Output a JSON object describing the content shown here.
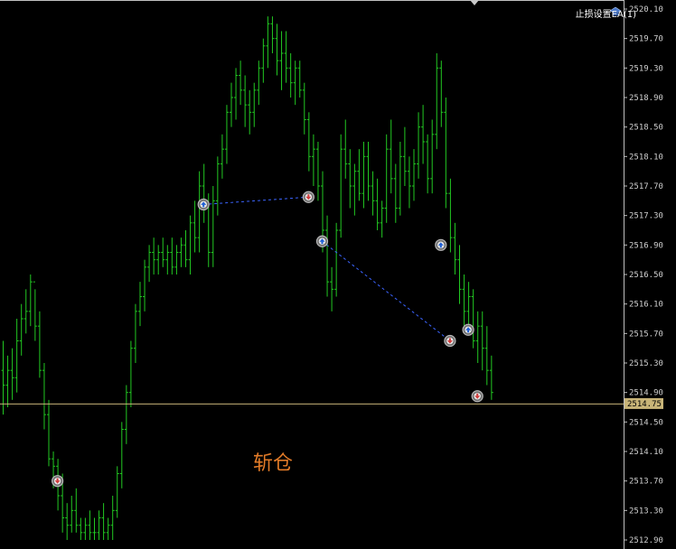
{
  "window": {
    "ea_name": "止损设置EA(1)",
    "overlay_text": "斩仓"
  },
  "colors": {
    "background": "#000000",
    "candle": "#22c822",
    "grid_axis": "#c0c0c0",
    "current_price_line": "#c8b478",
    "price_tag_bg": "#c8b478",
    "trade_link": "#3b64ff",
    "overlay_text": "#e07a28",
    "buy_arrow": "#1e5fd6",
    "sell_arrow": "#d23c3c"
  },
  "icons": {
    "ea_icon": "graduation-cap-icon",
    "buy_marker": "buy-arrow-icon",
    "sell_marker": "sell-arrow-icon"
  },
  "chart_data": {
    "type": "ohlc",
    "price_scale": {
      "min": 2512.9,
      "max": 2520.1,
      "tick_labels": [
        "2520.10",
        "2519.70",
        "2519.30",
        "2518.90",
        "2518.50",
        "2518.10",
        "2517.70",
        "2517.30",
        "2516.90",
        "2516.50",
        "2516.10",
        "2515.70",
        "2515.30",
        "2514.90",
        "2514.50",
        "2514.10",
        "2513.70",
        "2513.30",
        "2512.90"
      ]
    },
    "current_price": 2514.75,
    "current_price_label": "2514.75",
    "bars": [
      [
        2515.2,
        2515.6,
        2514.6,
        2515.0
      ],
      [
        2515.0,
        2515.4,
        2514.7,
        2515.2
      ],
      [
        2515.2,
        2515.5,
        2514.8,
        2515.1
      ],
      [
        2515.1,
        2515.9,
        2514.9,
        2515.6
      ],
      [
        2515.6,
        2516.1,
        2515.4,
        2515.9
      ],
      [
        2515.9,
        2516.3,
        2515.7,
        2516.0
      ],
      [
        2516.0,
        2516.5,
        2515.8,
        2516.4
      ],
      [
        2516.4,
        2516.3,
        2515.6,
        2515.8
      ],
      [
        2515.8,
        2516.0,
        2515.1,
        2515.2
      ],
      [
        2515.2,
        2515.3,
        2514.4,
        2514.6
      ],
      [
        2514.6,
        2514.8,
        2513.9,
        2514.0
      ],
      [
        2514.0,
        2514.1,
        2513.6,
        2513.9
      ],
      [
        2513.9,
        2514.0,
        2513.3,
        2513.5
      ],
      [
        2513.5,
        2513.8,
        2513.0,
        2513.2
      ],
      [
        2513.2,
        2513.4,
        2512.9,
        2513.1
      ],
      [
        2513.1,
        2513.5,
        2513.0,
        2513.3
      ],
      [
        2513.3,
        2513.6,
        2513.0,
        2513.1
      ],
      [
        2513.1,
        2513.2,
        2512.9,
        2513.0
      ],
      [
        2513.0,
        2513.2,
        2512.9,
        2513.1
      ],
      [
        2513.1,
        2513.3,
        2512.9,
        2513.0
      ],
      [
        2513.0,
        2513.2,
        2512.9,
        2513.0
      ],
      [
        2513.0,
        2513.3,
        2512.9,
        2513.2
      ],
      [
        2513.2,
        2513.4,
        2512.9,
        2513.0
      ],
      [
        2513.0,
        2513.2,
        2512.9,
        2513.1
      ],
      [
        2513.1,
        2513.5,
        2512.9,
        2513.3
      ],
      [
        2513.3,
        2513.9,
        2513.2,
        2513.8
      ],
      [
        2513.8,
        2514.5,
        2513.6,
        2514.4
      ],
      [
        2514.4,
        2515.0,
        2514.2,
        2514.9
      ],
      [
        2514.9,
        2515.6,
        2514.7,
        2515.5
      ],
      [
        2515.5,
        2516.1,
        2515.3,
        2516.0
      ],
      [
        2516.0,
        2516.4,
        2515.8,
        2516.2
      ],
      [
        2516.2,
        2516.7,
        2516.0,
        2516.6
      ],
      [
        2516.6,
        2516.9,
        2516.4,
        2516.8
      ],
      [
        2516.8,
        2517.0,
        2516.5,
        2516.7
      ],
      [
        2516.7,
        2516.9,
        2516.5,
        2516.8
      ],
      [
        2516.8,
        2517.0,
        2516.6,
        2516.7
      ],
      [
        2516.7,
        2516.9,
        2516.5,
        2516.8
      ],
      [
        2516.8,
        2517.0,
        2516.5,
        2516.6
      ],
      [
        2516.6,
        2516.9,
        2516.5,
        2516.8
      ],
      [
        2516.8,
        2517.0,
        2516.6,
        2516.9
      ],
      [
        2516.9,
        2517.1,
        2516.6,
        2516.7
      ],
      [
        2516.7,
        2517.3,
        2516.5,
        2517.2
      ],
      [
        2517.2,
        2517.5,
        2516.8,
        2517.0
      ],
      [
        2517.0,
        2517.9,
        2516.8,
        2517.7
      ],
      [
        2517.7,
        2518.0,
        2517.2,
        2517.4
      ],
      [
        2517.4,
        2517.6,
        2516.6,
        2516.8
      ],
      [
        2516.8,
        2517.7,
        2516.6,
        2517.5
      ],
      [
        2517.5,
        2518.1,
        2517.3,
        2518.0
      ],
      [
        2518.0,
        2518.4,
        2517.8,
        2518.2
      ],
      [
        2518.2,
        2518.8,
        2518.0,
        2518.7
      ],
      [
        2518.7,
        2519.1,
        2518.5,
        2518.9
      ],
      [
        2518.9,
        2519.3,
        2518.6,
        2519.2
      ],
      [
        2519.2,
        2519.4,
        2518.8,
        2519.0
      ],
      [
        2519.0,
        2519.2,
        2518.5,
        2518.8
      ],
      [
        2518.8,
        2519.0,
        2518.4,
        2518.7
      ],
      [
        2518.7,
        2519.1,
        2518.5,
        2519.0
      ],
      [
        2519.0,
        2519.4,
        2518.8,
        2519.3
      ],
      [
        2519.3,
        2519.7,
        2519.1,
        2519.6
      ],
      [
        2519.6,
        2520.0,
        2519.3,
        2519.9
      ],
      [
        2519.9,
        2520.0,
        2519.5,
        2519.7
      ],
      [
        2519.7,
        2519.9,
        2519.2,
        2519.4
      ],
      [
        2519.4,
        2519.8,
        2519.0,
        2519.5
      ],
      [
        2519.5,
        2519.8,
        2519.1,
        2519.3
      ],
      [
        2519.3,
        2519.5,
        2518.9,
        2519.1
      ],
      [
        2519.1,
        2519.4,
        2518.8,
        2519.3
      ],
      [
        2519.3,
        2519.4,
        2518.9,
        2519.0
      ],
      [
        2519.0,
        2519.1,
        2518.4,
        2518.6
      ],
      [
        2518.6,
        2518.7,
        2517.9,
        2518.1
      ],
      [
        2518.1,
        2518.4,
        2517.7,
        2518.2
      ],
      [
        2518.2,
        2518.3,
        2517.5,
        2517.7
      ],
      [
        2517.7,
        2517.9,
        2516.8,
        2517.1
      ],
      [
        2517.1,
        2517.3,
        2516.2,
        2516.4
      ],
      [
        2516.4,
        2516.6,
        2516.0,
        2516.3
      ],
      [
        2516.3,
        2517.2,
        2516.2,
        2517.1
      ],
      [
        2517.1,
        2518.4,
        2517.0,
        2518.2
      ],
      [
        2518.2,
        2518.6,
        2517.8,
        2518.0
      ],
      [
        2518.0,
        2518.2,
        2517.4,
        2517.7
      ],
      [
        2517.7,
        2518.0,
        2517.3,
        2517.9
      ],
      [
        2517.9,
        2518.2,
        2517.5,
        2517.6
      ],
      [
        2517.6,
        2518.3,
        2517.4,
        2518.1
      ],
      [
        2518.1,
        2518.3,
        2517.5,
        2517.7
      ],
      [
        2517.7,
        2517.9,
        2517.3,
        2517.5
      ],
      [
        2517.5,
        2517.8,
        2517.1,
        2517.2
      ],
      [
        2517.2,
        2517.5,
        2517.0,
        2517.4
      ],
      [
        2517.4,
        2518.4,
        2517.2,
        2518.2
      ],
      [
        2518.2,
        2518.6,
        2517.6,
        2517.8
      ],
      [
        2517.8,
        2518.0,
        2517.2,
        2517.4
      ],
      [
        2517.4,
        2518.3,
        2517.3,
        2518.1
      ],
      [
        2518.1,
        2518.5,
        2517.7,
        2517.9
      ],
      [
        2517.9,
        2518.1,
        2517.4,
        2517.7
      ],
      [
        2517.7,
        2518.2,
        2517.5,
        2518.0
      ],
      [
        2518.0,
        2518.7,
        2517.8,
        2518.5
      ],
      [
        2518.5,
        2518.8,
        2518.0,
        2518.3
      ],
      [
        2518.3,
        2518.4,
        2517.6,
        2517.8
      ],
      [
        2517.8,
        2518.6,
        2517.6,
        2518.4
      ],
      [
        2518.4,
        2519.5,
        2518.2,
        2519.3
      ],
      [
        2519.3,
        2519.4,
        2518.5,
        2518.7
      ],
      [
        2518.7,
        2518.9,
        2517.4,
        2517.6
      ],
      [
        2517.6,
        2517.8,
        2516.8,
        2517.0
      ],
      [
        2517.0,
        2517.2,
        2516.5,
        2516.7
      ],
      [
        2516.7,
        2516.9,
        2516.1,
        2516.3
      ],
      [
        2516.3,
        2516.5,
        2515.8,
        2516.0
      ],
      [
        2516.0,
        2516.4,
        2515.7,
        2516.2
      ],
      [
        2516.2,
        2516.3,
        2515.5,
        2515.6
      ],
      [
        2515.6,
        2516.0,
        2515.3,
        2515.8
      ],
      [
        2515.8,
        2516.0,
        2515.2,
        2515.5
      ],
      [
        2515.5,
        2515.8,
        2515.0,
        2515.2
      ],
      [
        2515.2,
        2515.4,
        2514.8,
        2514.9
      ]
    ],
    "trades": [
      {
        "bar": 44,
        "price": 2517.45,
        "side": "buy"
      },
      {
        "bar": 67,
        "price": 2517.55,
        "side": "sell"
      },
      {
        "bar": 70,
        "price": 2516.95,
        "side": "buy"
      },
      {
        "bar": 96,
        "price": 2516.9,
        "side": "buy"
      },
      {
        "bar": 98,
        "price": 2515.6,
        "side": "sell"
      },
      {
        "bar": 102,
        "price": 2515.75,
        "side": "buy"
      },
      {
        "bar": 104,
        "price": 2514.85,
        "side": "sell"
      },
      {
        "bar": 12,
        "price": 2513.7,
        "side": "sell"
      }
    ],
    "trade_links": [
      [
        0,
        1
      ],
      [
        2,
        4
      ]
    ]
  }
}
